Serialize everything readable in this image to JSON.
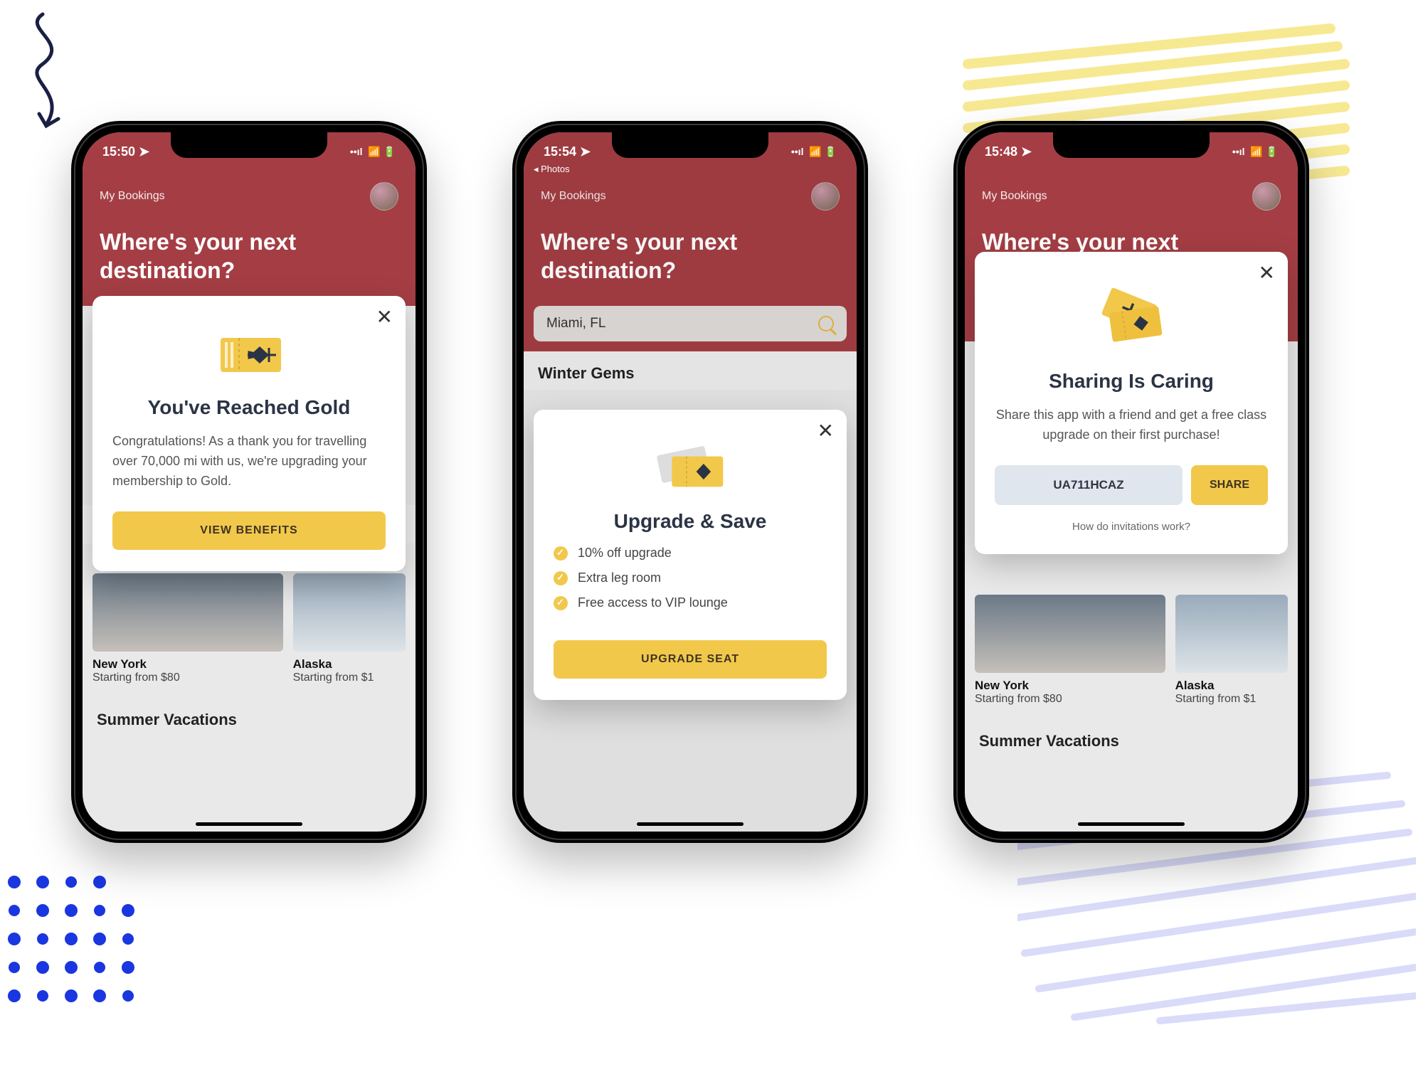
{
  "colors": {
    "brand": "#a43e44",
    "accent": "#f2c84b"
  },
  "status": {
    "t1": "15:50",
    "t2": "15:54",
    "t3": "15:48",
    "back_app": "◂ Photos"
  },
  "header": {
    "bookings": "My Bookings",
    "title": "Where's your next destination?",
    "title_short": "Where's your next"
  },
  "search": {
    "value": "Miami, FL"
  },
  "sections": {
    "winter": "Winter Gems",
    "summer": "Summer Vacations"
  },
  "destinations": [
    {
      "name": "New York",
      "price": "Starting from $80"
    },
    {
      "name": "Alaska",
      "price": "Starting from $1"
    }
  ],
  "modal1": {
    "title": "You've Reached Gold",
    "body": "Congratulations! As a thank you for travelling over 70,000 mi with us, we're upgrading your membership to Gold.",
    "cta": "VIEW BENEFITS"
  },
  "modal2": {
    "title": "Upgrade & Save",
    "benefits": [
      "10% off upgrade",
      "Extra leg room",
      "Free access to VIP lounge"
    ],
    "cta": "UPGRADE SEAT"
  },
  "modal3": {
    "title": "Sharing Is Caring",
    "body": "Share this app with a friend and get a free class upgrade on their first purchase!",
    "code": "UA711HCAZ",
    "share": "SHARE",
    "help": "How do invitations work?"
  }
}
